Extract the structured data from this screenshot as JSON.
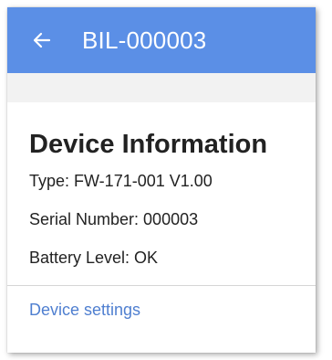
{
  "appbar": {
    "title": "BIL-000003",
    "back_icon": "arrow-left-icon",
    "color": "#5b8fe6"
  },
  "device_info": {
    "heading": "Device Information",
    "type": "Type: FW-171-001 V1.00",
    "serial": "Serial Number: 000003",
    "battery": "Battery Level: OK"
  },
  "links": {
    "device_settings": "Device settings",
    "color": "#4f7fd0"
  }
}
